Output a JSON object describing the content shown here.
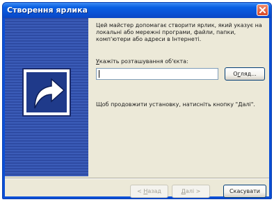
{
  "window": {
    "title": "Створення ярлика"
  },
  "wizard": {
    "description": "Цей майстер допомагає створити ярлик, який указує на локальні або мережні програми, файли, папки, комп'ютери або адреси в Інтернеті.",
    "location_label_hotkey": "У",
    "location_label_rest": "кажіть розташування об'єкта:",
    "location_value": "",
    "browse_label_pre": "О",
    "browse_label_hotkey": "г",
    "browse_label_post": "ляд...",
    "hint": "Щоб продовжити установку, натисніть кнопку \"Далі\"."
  },
  "buttons": {
    "back_pre": "< ",
    "back_hotkey": "Н",
    "back_post": "азад",
    "next_hotkey": "Д",
    "next_post": "алі >",
    "cancel": "Скасувати"
  },
  "colors": {
    "titlebar": "#0a5fe3",
    "side_panel": "#2e4ba3",
    "client": "#ece9d8"
  },
  "icons": [
    "close-icon",
    "shortcut-arrow-icon"
  ]
}
